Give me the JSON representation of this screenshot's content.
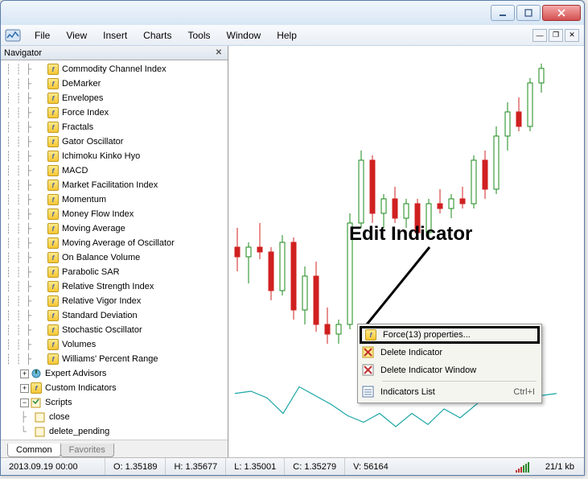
{
  "menus": {
    "file": "File",
    "view": "View",
    "insert": "Insert",
    "charts": "Charts",
    "tools": "Tools",
    "window": "Window",
    "help": "Help"
  },
  "navigator": {
    "title": "Navigator",
    "tabs": {
      "common": "Common",
      "favorites": "Favorites"
    },
    "indicators": [
      "Commodity Channel Index",
      "DeMarker",
      "Envelopes",
      "Force Index",
      "Fractals",
      "Gator Oscillator",
      "Ichimoku Kinko Hyo",
      "MACD",
      "Market Facilitation Index",
      "Momentum",
      "Money Flow Index",
      "Moving Average",
      "Moving Average of Oscillator",
      "On Balance Volume",
      "Parabolic SAR",
      "Relative Strength Index",
      "Relative Vigor Index",
      "Standard Deviation",
      "Stochastic Oscillator",
      "Volumes",
      "Williams' Percent Range"
    ],
    "groups": {
      "ea": "Expert Advisors",
      "custom": "Custom Indicators",
      "scripts": "Scripts",
      "close": "close",
      "dp": "delete_pending"
    }
  },
  "annotation": {
    "label": "Edit Indicator"
  },
  "ctx": {
    "props": "Force(13) properties...",
    "del": "Delete Indicator",
    "delwin": "Delete Indicator Window",
    "list": "Indicators List",
    "shortcut": "Ctrl+I"
  },
  "status": {
    "time": "2013.09.19 00:00",
    "o": "O: 1.35189",
    "h": "H: 1.35677",
    "l": "L: 1.35001",
    "c": "C: 1.35279",
    "v": "V: 56164",
    "kb": "21/1 kb"
  },
  "chart_data": {
    "type": "candlestick",
    "title": "",
    "xlabel": "",
    "ylabel": "",
    "ylim": [
      1.348,
      1.36
    ],
    "candles": [
      {
        "o": 1.352,
        "h": 1.3528,
        "l": 1.351,
        "c": 1.3516,
        "up": false
      },
      {
        "o": 1.3516,
        "h": 1.3522,
        "l": 1.3505,
        "c": 1.352,
        "up": true
      },
      {
        "o": 1.352,
        "h": 1.353,
        "l": 1.3515,
        "c": 1.3518,
        "up": false
      },
      {
        "o": 1.3518,
        "h": 1.352,
        "l": 1.3498,
        "c": 1.3502,
        "up": false
      },
      {
        "o": 1.3502,
        "h": 1.3525,
        "l": 1.35,
        "c": 1.3522,
        "up": true
      },
      {
        "o": 1.3522,
        "h": 1.3524,
        "l": 1.349,
        "c": 1.3494,
        "up": false
      },
      {
        "o": 1.3494,
        "h": 1.3512,
        "l": 1.3488,
        "c": 1.3508,
        "up": true
      },
      {
        "o": 1.3508,
        "h": 1.3514,
        "l": 1.3485,
        "c": 1.3488,
        "up": false
      },
      {
        "o": 1.3488,
        "h": 1.3495,
        "l": 1.348,
        "c": 1.3484,
        "up": false
      },
      {
        "o": 1.3484,
        "h": 1.349,
        "l": 1.348,
        "c": 1.3488,
        "up": true
      },
      {
        "o": 1.3488,
        "h": 1.3534,
        "l": 1.3486,
        "c": 1.353,
        "up": true
      },
      {
        "o": 1.353,
        "h": 1.356,
        "l": 1.3528,
        "c": 1.3556,
        "up": true
      },
      {
        "o": 1.3556,
        "h": 1.3558,
        "l": 1.353,
        "c": 1.3534,
        "up": false
      },
      {
        "o": 1.3534,
        "h": 1.3542,
        "l": 1.3528,
        "c": 1.354,
        "up": true
      },
      {
        "o": 1.354,
        "h": 1.3545,
        "l": 1.353,
        "c": 1.3532,
        "up": false
      },
      {
        "o": 1.3532,
        "h": 1.354,
        "l": 1.3528,
        "c": 1.3538,
        "up": true
      },
      {
        "o": 1.3538,
        "h": 1.354,
        "l": 1.3524,
        "c": 1.3526,
        "up": false
      },
      {
        "o": 1.3526,
        "h": 1.354,
        "l": 1.3524,
        "c": 1.3538,
        "up": true
      },
      {
        "o": 1.3538,
        "h": 1.3544,
        "l": 1.3534,
        "c": 1.3536,
        "up": false
      },
      {
        "o": 1.3536,
        "h": 1.3542,
        "l": 1.3532,
        "c": 1.354,
        "up": true
      },
      {
        "o": 1.354,
        "h": 1.3545,
        "l": 1.3536,
        "c": 1.3538,
        "up": false
      },
      {
        "o": 1.3538,
        "h": 1.3558,
        "l": 1.3536,
        "c": 1.3556,
        "up": true
      },
      {
        "o": 1.3556,
        "h": 1.356,
        "l": 1.354,
        "c": 1.3544,
        "up": false
      },
      {
        "o": 1.3544,
        "h": 1.357,
        "l": 1.3542,
        "c": 1.3566,
        "up": true
      },
      {
        "o": 1.3566,
        "h": 1.358,
        "l": 1.356,
        "c": 1.3576,
        "up": true
      },
      {
        "o": 1.3576,
        "h": 1.3582,
        "l": 1.3568,
        "c": 1.357,
        "up": false
      },
      {
        "o": 1.357,
        "h": 1.359,
        "l": 1.3568,
        "c": 1.3588,
        "up": true
      },
      {
        "o": 1.3588,
        "h": 1.3596,
        "l": 1.3584,
        "c": 1.3594,
        "up": true
      }
    ],
    "subplot": {
      "type": "line",
      "name": "Force(13)",
      "color": "#1aa5a5",
      "ylim": [
        -1,
        1
      ],
      "values": [
        0.15,
        0.2,
        0.05,
        -0.3,
        0.3,
        0.1,
        -0.1,
        -0.35,
        -0.5,
        -0.3,
        -0.6,
        -0.3,
        -0.55,
        -0.2,
        -0.4,
        -0.1,
        0.25,
        -0.03,
        0.2,
        0.1,
        0.15
      ]
    }
  }
}
